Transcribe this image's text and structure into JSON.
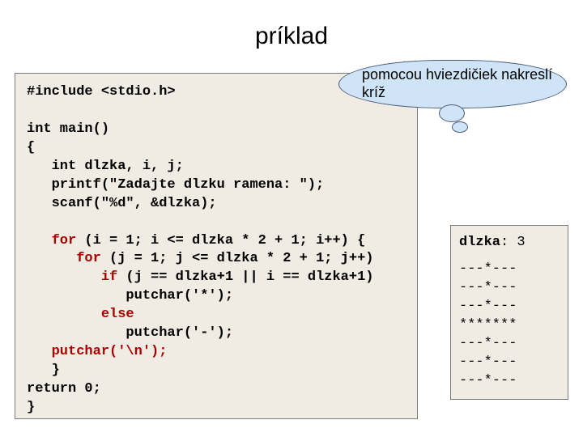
{
  "title": "príklad",
  "callout": "pomocou hviezdičiek nakreslí kríž",
  "code": {
    "l1": "#include <stdio.h>",
    "l2": "int main()",
    "l3": "{",
    "l4": "   int dlzka, i, j;",
    "l5": "   printf(\"Zadajte dlzku ramena: \");",
    "l6": "   scanf(\"%d\", &dlzka);",
    "kw_for1": "for",
    "l7_rest": " (i = 1; i <= dlzka * 2 + 1; i++) {",
    "kw_for2": "for",
    "l8_rest": " (j = 1; j <= dlzka * 2 + 1; j++)",
    "kw_if": "if",
    "l9_rest": " (j == dlzka+1 || i == dlzka+1)",
    "l10": "            putchar('*');",
    "kw_else": "else",
    "l12": "            putchar('-');",
    "kw_putnl": "putchar('\\n');",
    "l14": "   }",
    "l15": "return 0;",
    "l16": "}"
  },
  "output": {
    "var": "dlzka",
    "colon": ": ",
    "value": "3",
    "lines": "---*---\n---*---\n---*---\n*******\n---*---\n---*---\n---*---"
  }
}
